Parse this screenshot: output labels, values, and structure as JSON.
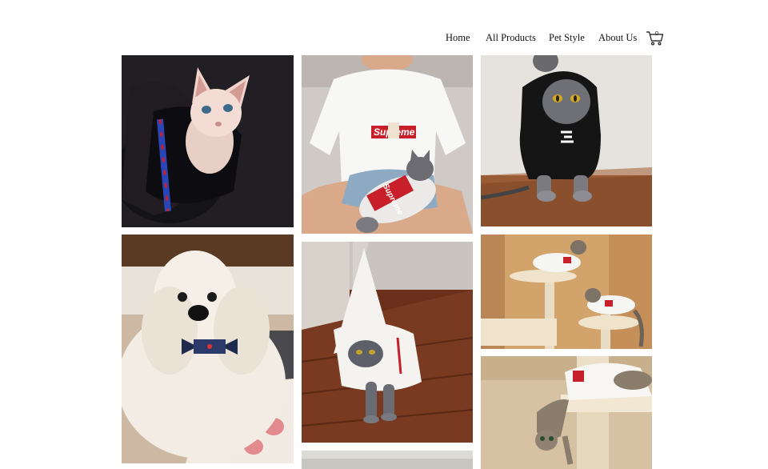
{
  "nav": {
    "items": [
      {
        "label": "Home"
      },
      {
        "label": "All Products"
      },
      {
        "label": "Pet Style"
      },
      {
        "label": "About Us"
      }
    ],
    "cart_count": "0"
  },
  "gallery": {
    "photos": [
      {
        "subject": "hairless cat in black sweater",
        "icon": "photo-sphynx-cat"
      },
      {
        "subject": "person and cat in white tees",
        "icon": "photo-person-with-cat",
        "print_text": "Supreme"
      },
      {
        "subject": "grey cat in black hoodie",
        "icon": "photo-cat-black-hoodie"
      },
      {
        "subject": "white dog with bow tie",
        "icon": "photo-dog-bowtie"
      },
      {
        "subject": "grey cat in white hoodie",
        "icon": "photo-cat-white-hoodie"
      },
      {
        "subject": "two cats on cat tree",
        "icon": "photo-cats-tree"
      },
      {
        "subject": "cat hanging on cat tree",
        "icon": "photo-cat-hanging"
      },
      {
        "subject": "partial photo",
        "icon": "photo-partial"
      }
    ]
  },
  "colors": {
    "accent_red": "#c8202a",
    "text": "#111111",
    "background": "#ffffff"
  }
}
